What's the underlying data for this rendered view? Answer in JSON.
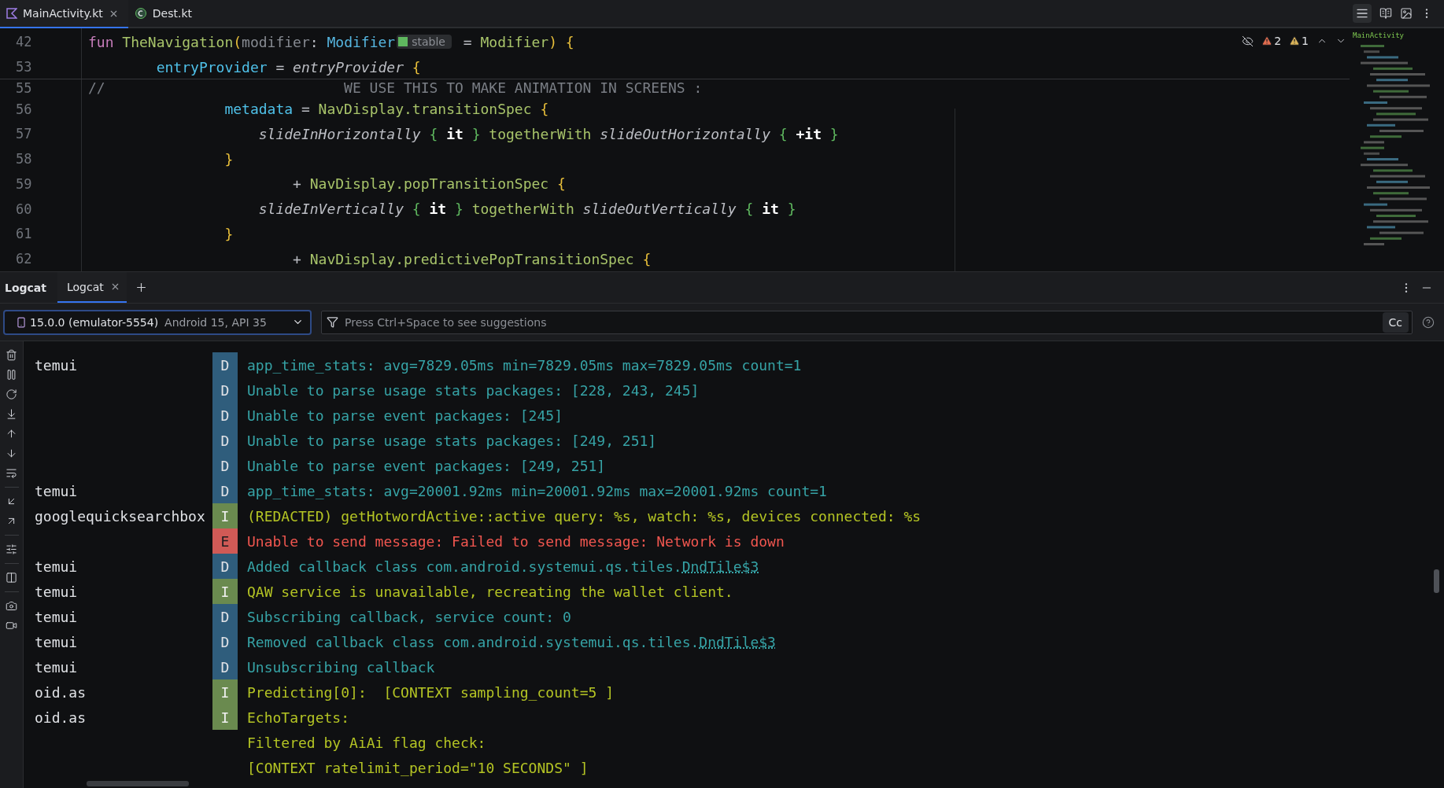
{
  "editor_tabs": [
    {
      "label": "MainActivity.kt",
      "selected": true,
      "kind": "kotlin"
    },
    {
      "label": "Dest.kt",
      "selected": false,
      "kind": "class"
    }
  ],
  "inspections": {
    "errors": "2",
    "warnings": "1"
  },
  "minimap": {
    "title": "MainActivity"
  },
  "sticky_lines": [
    {
      "number": "42",
      "tokens": [
        {
          "text": "fun ",
          "kind": "keyword"
        },
        {
          "text": "TheNavigation",
          "kind": "function"
        },
        {
          "text": "(",
          "kind": "brace"
        },
        {
          "text": "modifier",
          "kind": "param"
        },
        {
          "text": ": ",
          "kind": "plain"
        },
        {
          "text": "Modifier",
          "kind": "type"
        },
        {
          "text": "stable",
          "kind": "hint"
        },
        {
          "text": " = ",
          "kind": "plain"
        },
        {
          "text": "Modifier",
          "kind": "function"
        },
        {
          "text": ") ",
          "kind": "brace"
        },
        {
          "text": "{",
          "kind": "brace"
        }
      ]
    },
    {
      "number": "53",
      "tokens": [
        {
          "text": "        entryProvider",
          "kind": "property"
        },
        {
          "text": " = ",
          "kind": "plain"
        },
        {
          "text": "entryProvider",
          "kind": "italic"
        },
        {
          "text": " {",
          "kind": "brace"
        }
      ]
    }
  ],
  "code_lines": [
    {
      "number": "55",
      "tokens": [
        {
          "text": "//                            WE USE THIS TO MAKE ANIMATION IN SCREENS :",
          "kind": "comment"
        }
      ]
    },
    {
      "number": "56",
      "tokens": [
        {
          "text": "                metadata",
          "kind": "property"
        },
        {
          "text": " = ",
          "kind": "plain"
        },
        {
          "text": "NavDisplay.transitionSpec",
          "kind": "function"
        },
        {
          "text": " {",
          "kind": "brace"
        }
      ]
    },
    {
      "number": "57",
      "tokens": [
        {
          "text": "                    slideInHorizontally",
          "kind": "italic"
        },
        {
          "text": " { ",
          "kind": "lambda"
        },
        {
          "text": "it",
          "kind": "bold"
        },
        {
          "text": " } ",
          "kind": "lambda"
        },
        {
          "text": "togetherWith ",
          "kind": "function"
        },
        {
          "text": "slideOutHorizontally",
          "kind": "italic"
        },
        {
          "text": " { ",
          "kind": "lambda"
        },
        {
          "text": "+it",
          "kind": "bold"
        },
        {
          "text": " }",
          "kind": "lambda"
        }
      ]
    },
    {
      "number": "58",
      "tokens": [
        {
          "text": "                }",
          "kind": "brace"
        }
      ]
    },
    {
      "number": "59",
      "tokens": [
        {
          "text": "                        + ",
          "kind": "plain"
        },
        {
          "text": "NavDisplay.popTransitionSpec",
          "kind": "function"
        },
        {
          "text": " {",
          "kind": "brace"
        }
      ]
    },
    {
      "number": "60",
      "tokens": [
        {
          "text": "                    slideInVertically",
          "kind": "italic"
        },
        {
          "text": " { ",
          "kind": "lambda"
        },
        {
          "text": "it",
          "kind": "bold"
        },
        {
          "text": " } ",
          "kind": "lambda"
        },
        {
          "text": "togetherWith ",
          "kind": "function"
        },
        {
          "text": "slideOutVertically",
          "kind": "italic"
        },
        {
          "text": " { ",
          "kind": "lambda"
        },
        {
          "text": "it",
          "kind": "bold"
        },
        {
          "text": " }",
          "kind": "lambda"
        }
      ]
    },
    {
      "number": "61",
      "tokens": [
        {
          "text": "                }",
          "kind": "brace"
        }
      ]
    },
    {
      "number": "62",
      "tokens": [
        {
          "text": "                        + ",
          "kind": "plain"
        },
        {
          "text": "NavDisplay.predictivePopTransitionSpec",
          "kind": "function"
        },
        {
          "text": " {",
          "kind": "brace"
        }
      ]
    }
  ],
  "tool_window": {
    "title": "Logcat",
    "tabs": [
      {
        "label": "Logcat",
        "selected": true
      }
    ]
  },
  "device": {
    "name": "15.0.0 (emulator-5554)",
    "detail": "Android 15, API 35"
  },
  "filter": {
    "placeholder": "Press Ctrl+Space to see suggestions",
    "match_case": "Cc"
  },
  "log_rows": [
    {
      "tag": "temui",
      "kind": "debug",
      "level": "D",
      "message": "app_time_stats: avg=7829.05ms min=7829.05ms max=7829.05ms count=1"
    },
    {
      "tag": "",
      "kind": "debug",
      "level": "D",
      "message": "Unable to parse usage stats packages: [228, 243, 245]"
    },
    {
      "tag": "",
      "kind": "debug",
      "level": "D",
      "message": "Unable to parse event packages: [245]"
    },
    {
      "tag": "",
      "kind": "debug",
      "level": "D",
      "message": "Unable to parse usage stats packages: [249, 251]"
    },
    {
      "tag": "",
      "kind": "debug",
      "level": "D",
      "message": "Unable to parse event packages: [249, 251]"
    },
    {
      "tag": "temui",
      "kind": "debug",
      "level": "D",
      "message": "app_time_stats: avg=20001.92ms min=20001.92ms max=20001.92ms count=1"
    },
    {
      "tag": "googlequicksearchbox",
      "kind": "info",
      "level": "I",
      "message": "(REDACTED) getHotwordActive::active query: %s, watch: %s, devices connected: %s"
    },
    {
      "tag": "",
      "kind": "error",
      "level": "E",
      "message": "Unable to send message: Failed to send message: Network is down"
    },
    {
      "tag": "temui",
      "kind": "debug",
      "level": "D",
      "message": "Added callback class com.android.systemui.qs.tiles.",
      "link": "DndTile$3"
    },
    {
      "tag": "temui",
      "kind": "info",
      "level": "I",
      "message": "QAW service is unavailable, recreating the wallet client."
    },
    {
      "tag": "temui",
      "kind": "debug",
      "level": "D",
      "message": "Subscribing callback, service count: 0"
    },
    {
      "tag": "temui",
      "kind": "debug",
      "level": "D",
      "message": "Removed callback class com.android.systemui.qs.tiles.",
      "link": "DndTile$3"
    },
    {
      "tag": "temui",
      "kind": "debug",
      "level": "D",
      "message": "Unsubscribing callback"
    },
    {
      "tag": "oid.as",
      "kind": "info",
      "level": "I",
      "message": "Predicting[0]:  [CONTEXT sampling_count=5 ]"
    },
    {
      "tag": "oid.as",
      "kind": "info",
      "level": "I",
      "message": "EchoTargets:"
    },
    {
      "tag": "",
      "kind": "continuation",
      "level": "",
      "message": "Filtered by AiAi flag check:"
    },
    {
      "tag": "",
      "kind": "continuation",
      "level": "",
      "message": "[CONTEXT ratelimit_period=\"10 SECONDS\" ]"
    }
  ]
}
